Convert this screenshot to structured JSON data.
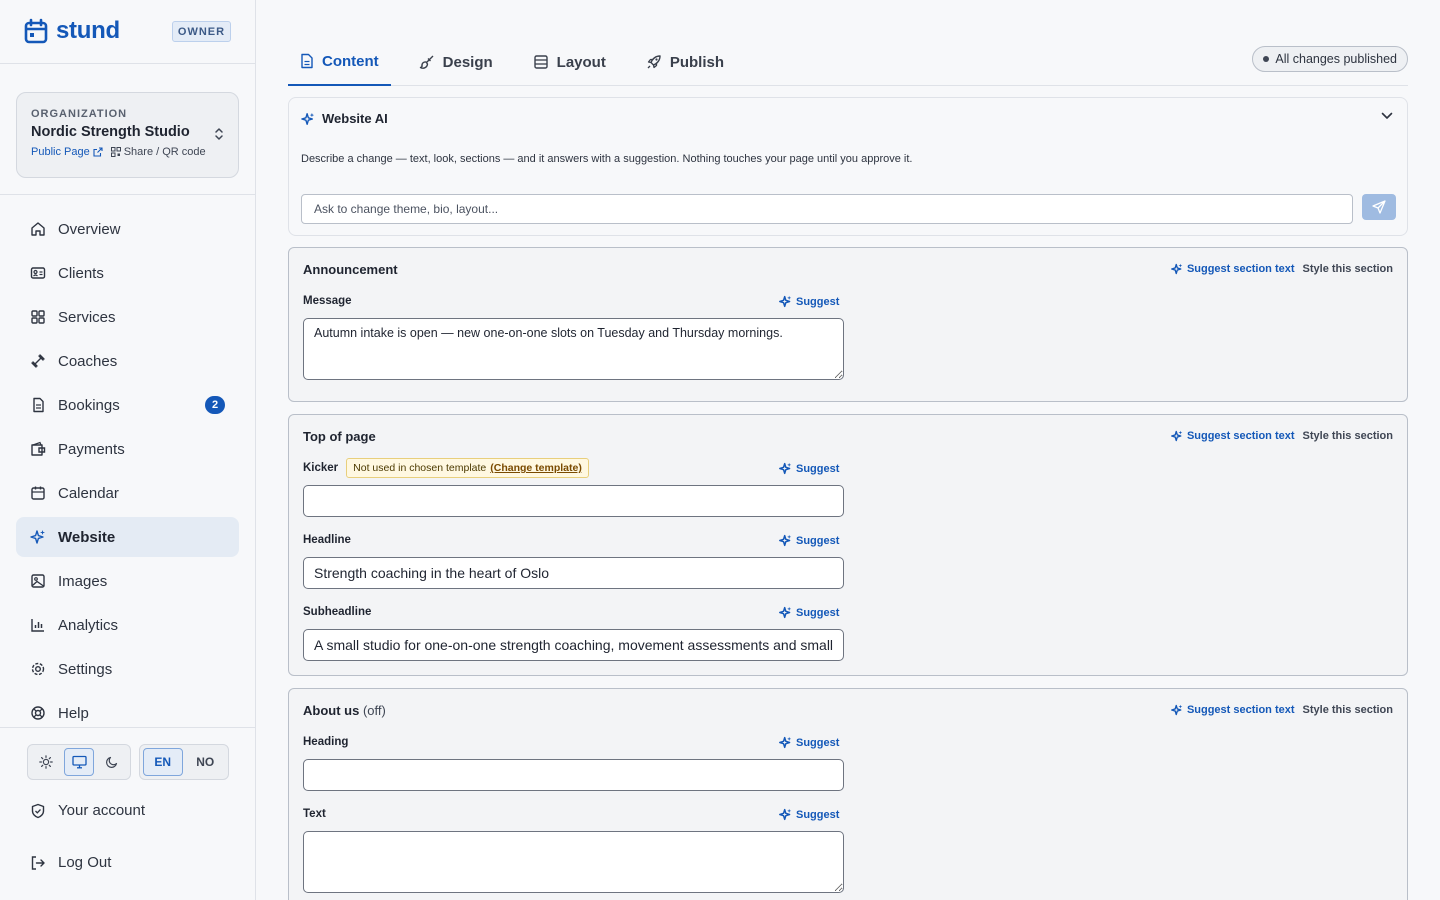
{
  "brand": {
    "name": "stund",
    "role_badge": "OWNER"
  },
  "organization": {
    "label": "ORGANIZATION",
    "name": "Nordic Strength Studio",
    "public_page": "Public Page",
    "share": "Share / QR code"
  },
  "nav": {
    "items": [
      {
        "label": "Overview",
        "icon": "home-icon"
      },
      {
        "label": "Clients",
        "icon": "id-card-icon"
      },
      {
        "label": "Services",
        "icon": "grid-icon"
      },
      {
        "label": "Coaches",
        "icon": "dumbbell-icon"
      },
      {
        "label": "Bookings",
        "icon": "document-icon",
        "badge": "2"
      },
      {
        "label": "Payments",
        "icon": "wallet-icon"
      },
      {
        "label": "Calendar",
        "icon": "calendar-icon"
      },
      {
        "label": "Website",
        "icon": "sparkle-icon",
        "active": true
      },
      {
        "label": "Images",
        "icon": "image-icon"
      },
      {
        "label": "Analytics",
        "icon": "chart-icon"
      },
      {
        "label": "Settings",
        "icon": "gear-icon"
      },
      {
        "label": "Help",
        "icon": "lifebuoy-icon"
      }
    ]
  },
  "lang": {
    "en": "EN",
    "no": "NO",
    "selected": "EN"
  },
  "footer": {
    "account": "Your account",
    "logout": "Log Out"
  },
  "tabs": [
    {
      "label": "Content",
      "active": true
    },
    {
      "label": "Design"
    },
    {
      "label": "Layout"
    },
    {
      "label": "Publish"
    }
  ],
  "publish_status": "All changes published",
  "ai": {
    "title": "Website AI",
    "description": "Describe a change — text, look, sections — and it answers with a suggestion. Nothing touches your page until you approve it.",
    "placeholder": "Ask to change theme, bio, layout..."
  },
  "actions": {
    "suggest_section": "Suggest section text",
    "style_section": "Style this section",
    "suggest": "Suggest"
  },
  "sections": {
    "announcement": {
      "title": "Announcement",
      "message_label": "Message",
      "message_value": "Autumn intake is open — new one-on-one slots on Tuesday and Thursday mornings."
    },
    "top": {
      "title": "Top of page",
      "kicker_label": "Kicker",
      "kicker_warning": "Not used in chosen template",
      "kicker_warning_link": "(Change template)",
      "kicker_value": "",
      "headline_label": "Headline",
      "headline_value": "Strength coaching in the heart of Oslo",
      "subheadline_label": "Subheadline",
      "subheadline_value": "A small studio for one-on-one strength coaching, movement assessments and small group training."
    },
    "about": {
      "title": "About us",
      "off_label": "(off)",
      "heading_label": "Heading",
      "heading_value": "",
      "text_label": "Text",
      "text_value": ""
    }
  },
  "colors": {
    "accent": "#1458b8",
    "border": "#b9bfc9",
    "warning_bg": "#fff8e1"
  }
}
